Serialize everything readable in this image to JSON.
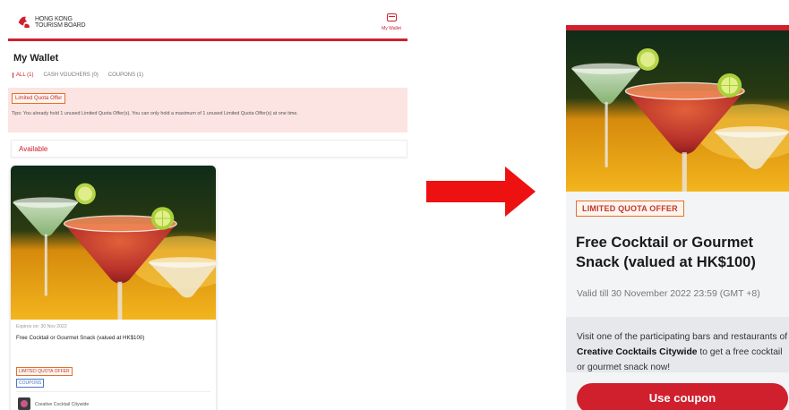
{
  "colors": {
    "brand_red": "#d0202e",
    "badge_orange": "#e4702e",
    "badge_blue": "#4a78c4",
    "tips_bg": "#fbe4e2"
  },
  "left": {
    "header": {
      "logo_line1": "HONG KONG",
      "logo_line2": "TOURISM BOARD",
      "logo_icon": "hktb-logo-icon",
      "wallet_icon": "wallet-icon",
      "wallet_label": "My Wallet"
    },
    "page_title": "My Wallet",
    "tabs": [
      {
        "label": "ALL (1)",
        "active": true
      },
      {
        "label": "CASH VOUCHERS (0)",
        "active": false
      },
      {
        "label": "COUPONS (1)",
        "active": false
      }
    ],
    "tips": {
      "badge": "Limited Quota Offer",
      "text": "Tips: You already hold 1 unused Limited Quota Offer(s). You can only hold a maximum of 1 unused Limited Quota Offer(s) at one time."
    },
    "available_label": "Available",
    "card": {
      "expires": "Expires on: 30 Nov 2022",
      "title": "Free Cocktail or Gourmet Snack (valued at HK$100)",
      "tag_quota": "LIMITED QUOTA OFFER",
      "tag_coupons": "COUPONS",
      "merchant": "Creative Cocktail Citywide"
    }
  },
  "arrow_icon": "right-arrow-icon",
  "right": {
    "badge": "LIMITED QUOTA OFFER",
    "title": "Free Cocktail or Gourmet Snack (valued at HK$100)",
    "valid": "Valid till 30 November 2022 23:59 (GMT +8)",
    "desc_before": "Visit one of the participating bars and restaurants of ",
    "desc_bold": "Creative Cocktails Citywide",
    "desc_after": " to get a free cocktail or gourmet snack now!",
    "button": "Use coupon"
  }
}
